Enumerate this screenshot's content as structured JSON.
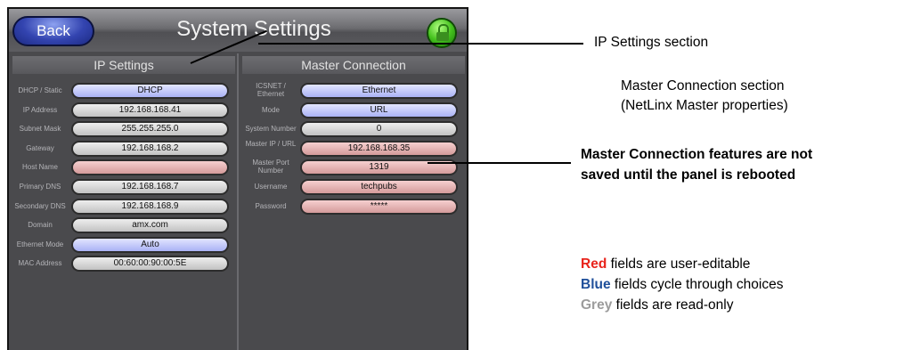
{
  "header": {
    "back_label": "Back",
    "title": "System Settings"
  },
  "ip_settings": {
    "heading": "IP Settings",
    "rows": [
      {
        "label": "DHCP / Static",
        "value": "DHCP",
        "kind": "blue"
      },
      {
        "label": "IP Address",
        "value": "192.168.168.41",
        "kind": "grey"
      },
      {
        "label": "Subnet Mask",
        "value": "255.255.255.0",
        "kind": "grey"
      },
      {
        "label": "Gateway",
        "value": "192.168.168.2",
        "kind": "grey"
      },
      {
        "label": "Host Name",
        "value": "",
        "kind": "red"
      },
      {
        "label": "Primary DNS",
        "value": "192.168.168.7",
        "kind": "grey"
      },
      {
        "label": "Secondary DNS",
        "value": "192.168.168.9",
        "kind": "grey"
      },
      {
        "label": "Domain",
        "value": "amx.com",
        "kind": "grey"
      },
      {
        "label": "Ethernet Mode",
        "value": "Auto",
        "kind": "blue"
      },
      {
        "label": "MAC Address",
        "value": "00:60:00:90:00:5E",
        "kind": "grey"
      }
    ]
  },
  "master_connection": {
    "heading": "Master Connection",
    "rows": [
      {
        "label": "ICSNET / Ethernet",
        "value": "Ethernet",
        "kind": "blue"
      },
      {
        "label": "Mode",
        "value": "URL",
        "kind": "blue"
      },
      {
        "label": "System Number",
        "value": "0",
        "kind": "grey"
      },
      {
        "label": "Master IP / URL",
        "value": "192.168.168.35",
        "kind": "red"
      },
      {
        "label": "Master Port Number",
        "value": "1319",
        "kind": "red"
      },
      {
        "label": "Username",
        "value": "techpubs",
        "kind": "red"
      },
      {
        "label": "Password",
        "value": "*****",
        "kind": "red"
      }
    ]
  },
  "annotations": {
    "ip_section": "IP Settings section",
    "master_section_1": "Master Connection section",
    "master_section_2": "(NetLinx Master properties)",
    "reboot_1": "Master Connection features are not",
    "reboot_2": "saved until the panel is rebooted",
    "legend_red_word": "Red",
    "legend_red_rest": " fields are user-editable",
    "legend_blue_word": "Blue",
    "legend_blue_rest": " fields cycle through choices",
    "legend_grey_word": "Grey",
    "legend_grey_rest": " fields are read-only"
  },
  "colors": {
    "legend_red": "#e8231b",
    "legend_blue": "#1f4f9a",
    "legend_grey": "#9c9c9c",
    "field_blue": "#b8bff8",
    "field_grey": "#d0d0d0",
    "field_red": "#e0aaaa"
  },
  "icons": {
    "lock": "lock-icon"
  }
}
